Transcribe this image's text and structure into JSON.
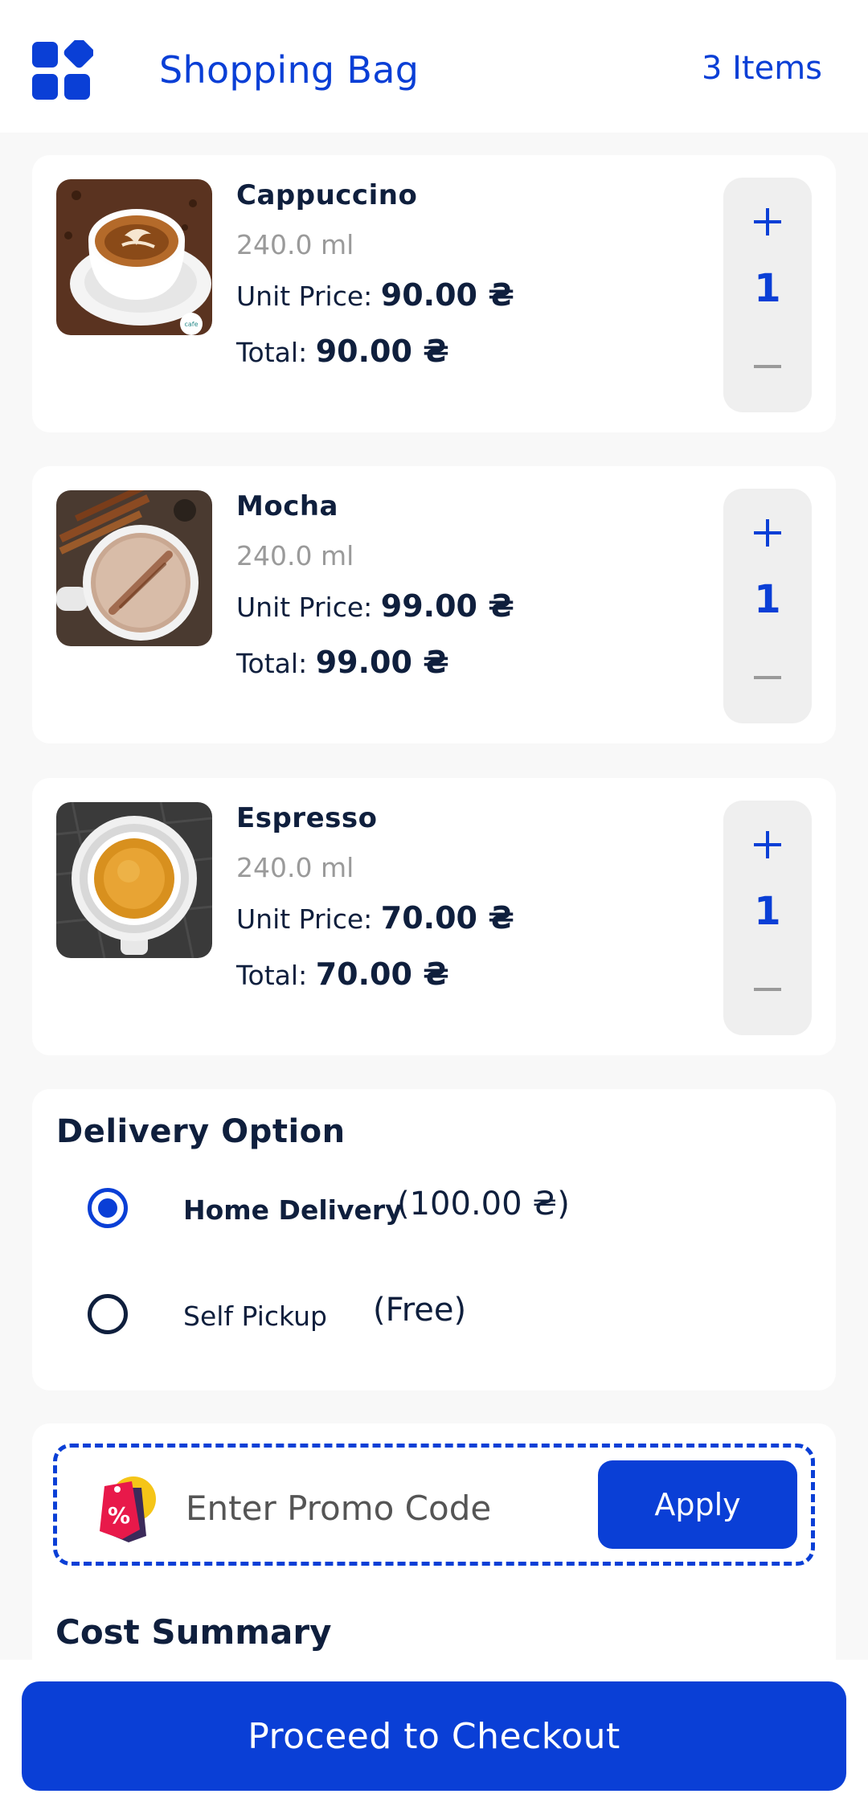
{
  "header": {
    "title": "Shopping Bag",
    "items_count": "3 Items",
    "menu_icon": "grid-icon"
  },
  "products": [
    {
      "name": "Cappuccino",
      "size": "240.0 ml",
      "unit_label": "Unit Price:",
      "unit_price": "90.00 ₴",
      "total_label": "Total:",
      "total": "90.00 ₴",
      "quantity": "1",
      "image": "cappuccino-latte-art"
    },
    {
      "name": "Mocha",
      "size": "240.0 ml",
      "unit_label": "Unit Price:",
      "unit_price": "99.00 ₴",
      "total_label": "Total:",
      "total": "99.00 ₴",
      "quantity": "1",
      "image": "mocha-with-cinnamon"
    },
    {
      "name": "Espresso",
      "size": "240.0 ml",
      "unit_label": "Unit Price:",
      "unit_price": "70.00 ₴",
      "total_label": "Total:",
      "total": "70.00 ₴",
      "quantity": "1",
      "image": "espresso-cup-top-view"
    }
  ],
  "delivery": {
    "title": "Delivery Option",
    "options": [
      {
        "label": "Home Delivery",
        "price": "(100.00 ₴)",
        "selected": true
      },
      {
        "label": "Self Pickup",
        "price": "(Free)",
        "selected": false
      }
    ]
  },
  "promo": {
    "placeholder": "Enter Promo Code",
    "apply_label": "Apply",
    "icon": "discount-tag-icon"
  },
  "cost_summary": {
    "title": "Cost Summary"
  },
  "checkout": {
    "label": "Proceed to Checkout"
  },
  "colors": {
    "accent": "#0a3fd6",
    "text_dark": "#0f1f3d",
    "muted": "#9a9a9a",
    "background": "#f8f8f8",
    "stepper_bg": "#efefef"
  }
}
